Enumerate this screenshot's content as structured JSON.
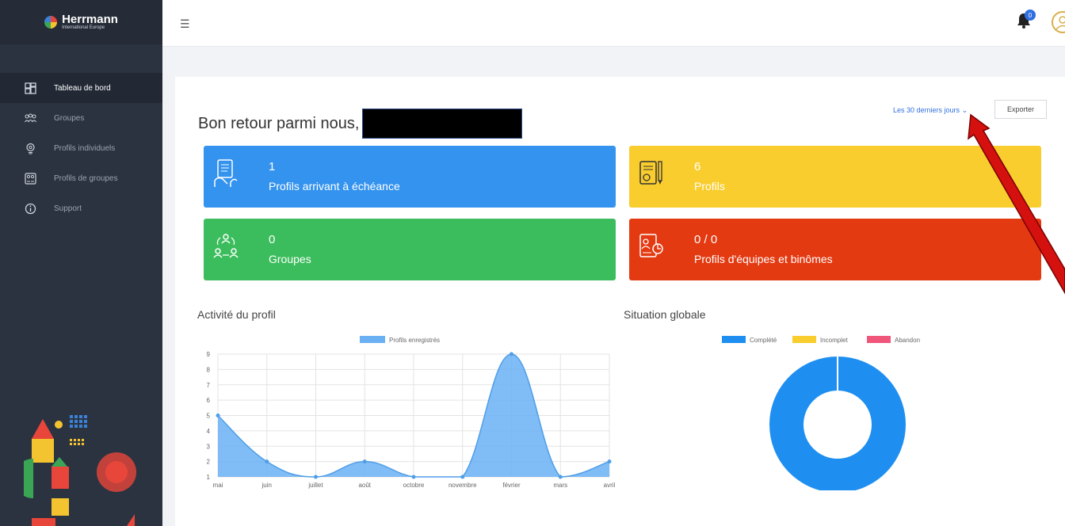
{
  "sidebar": {
    "logo": {
      "name": "Herrmann",
      "subtitle": "International Europe"
    },
    "items": [
      {
        "label": "Tableau de bord",
        "icon": "dashboard-icon"
      },
      {
        "label": "Groupes",
        "icon": "groups-icon"
      },
      {
        "label": "Profils individuels",
        "icon": "lightbulb-icon"
      },
      {
        "label": "Profils de groupes",
        "icon": "group-profile-icon"
      },
      {
        "label": "Support",
        "icon": "info-icon"
      }
    ]
  },
  "topbar": {
    "notifications_count": "0"
  },
  "main": {
    "welcome": "Bon retour parmi nous,",
    "period_label": "Les 30 derniers jours",
    "export_label": "Exporter",
    "stats": [
      {
        "value": "1",
        "label": "Profils arrivant à échéance",
        "color": "#3393ee"
      },
      {
        "value": "6",
        "label": "Profils",
        "color": "#f9cd2e"
      },
      {
        "value": "0",
        "label": "Groupes",
        "color": "#3cbd5d"
      },
      {
        "value": "0 / 0",
        "label": "Profils d'équipes et binômes",
        "color": "#e43a12"
      }
    ],
    "activity_title": "Activité du profil",
    "global_title": "Situation globale"
  },
  "chart_data": [
    {
      "type": "area",
      "title": "Activité du profil",
      "categories": [
        "mai",
        "juin",
        "juillet",
        "août",
        "octobre",
        "novembre",
        "février",
        "mars",
        "avril"
      ],
      "series": [
        {
          "name": "Profils enregistrés",
          "values": [
            5,
            2,
            1,
            2,
            1,
            1,
            9,
            1,
            2
          ],
          "color": "#6ab0f3"
        }
      ],
      "yticks": [
        1,
        2,
        3,
        4,
        5,
        6,
        7,
        8,
        9
      ],
      "ylim": [
        1,
        9
      ],
      "grid": true,
      "legend": "top"
    },
    {
      "type": "pie",
      "title": "Situation globale",
      "labels": [
        "Complété",
        "Incomplet",
        "Abandon"
      ],
      "values": [
        6,
        0,
        0
      ],
      "colors": [
        "#1e8ff0",
        "#f9cd2e",
        "#f0557a"
      ],
      "legend": "top"
    }
  ]
}
